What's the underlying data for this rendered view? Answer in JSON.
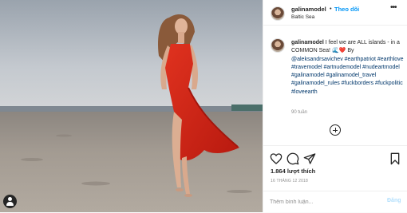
{
  "header": {
    "username": "galinamodel",
    "separator": "•",
    "follow_label": "Theo dõi",
    "location": "Baltic Sea",
    "more": "•••"
  },
  "caption": {
    "username": "galinamodel",
    "line1": " I feel we are ALL islands - in a COMMON Sea! ",
    "emoji": "🌊❤️",
    "line2": " By ",
    "tags": "@aleksandrsavichev #earthpatriot #earthlove #travemodel #artnudemodel #nudeartmodel #galinamodel #galinamodel_travel #galinamodel_rules #fuckborders #fuckpolitic #loveearth",
    "time": "90 tuần"
  },
  "actions": {
    "likes": "1.864 lượt thích",
    "date": "16 THÁNG 12 2018"
  },
  "comment": {
    "placeholder": "Thêm bình luận...",
    "post_label": "Đăng"
  },
  "icons": {
    "heart": "heart-icon",
    "comment": "comment-icon",
    "share": "share-icon",
    "save": "bookmark-icon",
    "more_comments": "plus-circle-icon",
    "user": "user-icon"
  },
  "colors": {
    "link": "#0095f6",
    "hashtag": "#00376b",
    "dress": "#d9261c",
    "sky": "#b6bcc6",
    "sand": "#a39a90"
  }
}
